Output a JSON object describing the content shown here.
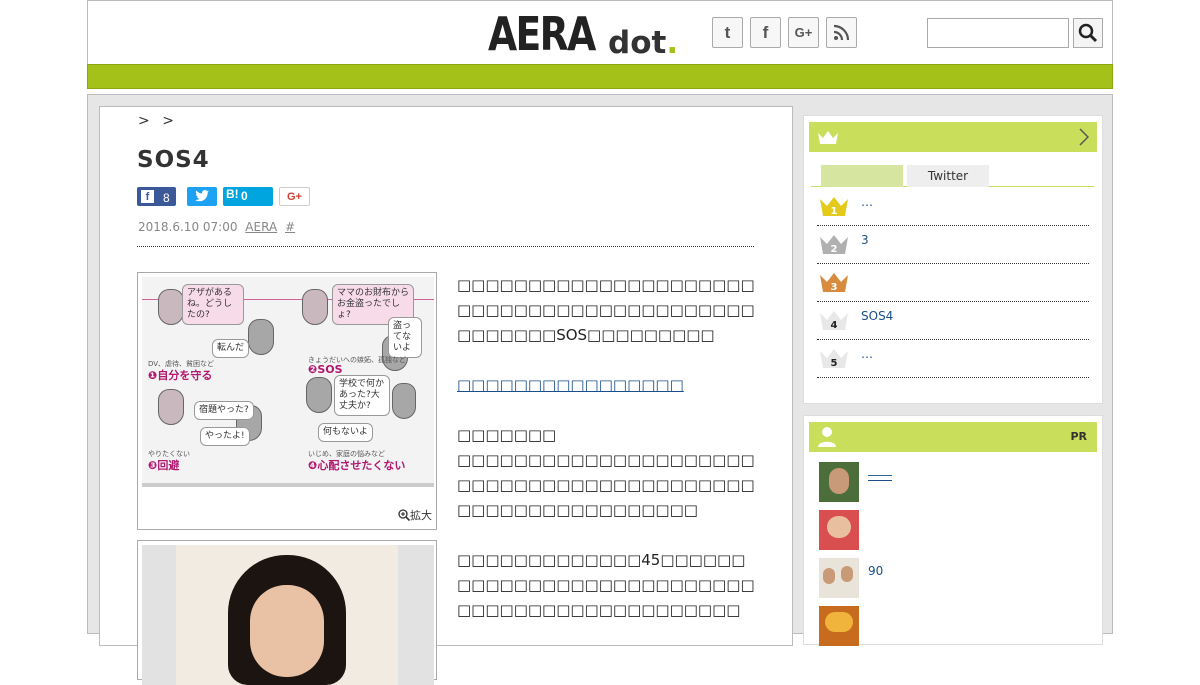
{
  "header": {
    "logo_main": "AERA",
    "logo_sub": "dot",
    "logo_period": ".",
    "social": {
      "twitter": "t",
      "facebook": "f",
      "google_plus": "G+",
      "rss": "RSS"
    },
    "search": {
      "value": "",
      "button_icon": "search-icon"
    }
  },
  "colors": {
    "accent": "#a4c11a",
    "sidebar_head": "#c9de5a",
    "link": "#1a4f8b",
    "caption": "#b2186f"
  },
  "article": {
    "breadcrumb": [
      ">",
      ">"
    ],
    "title": "SOS4",
    "share": {
      "facebook_count": "8",
      "hatena_label": "B!",
      "hatena_count": "0",
      "gplus_label": "G+"
    },
    "date": "2018.6.10 07:00",
    "source": "AERA",
    "tag": "#",
    "figure1": {
      "zoom_label": "拡大",
      "bubbles": [
        "アザがあるね。どうしたの?",
        "転んだ",
        "ママのお財布からお金盗ったでしょ?",
        "盗ってないよ",
        "宿題やった?",
        "やったよ!",
        "学校で何かあった?大丈夫か?",
        "何もないよ"
      ],
      "captions": [
        "❶自分を守る",
        "❷SOS",
        "❸回避",
        "❹心配させたくない"
      ],
      "sub_captions": [
        "DV、虐待、貧困など",
        "きょうだいへの嫉妬、孤独など",
        "やりたくない",
        "いじめ、家庭の悩みなど"
      ]
    },
    "paragraphs": [
      "□□□□□□□□□□□□□□□□□□□□□□□□□□□□□□□□□□□□□□□□□□□□□□□□□SOS□□□□□□□□□",
      "□□□□□□□□□□□□□□□□",
      "□□□□□□□",
      "□□□□□□□□□□□□□□□□□□□□□□□□□□□□□□□□□□□□□□□□□□□□□□□□□□□□□□□□□□□",
      "□□□□□□□□□□□□□45□□□□□□□□□□□□□□□□□□□□□□□□□□□□□□□□□□□□□□□□□□□□□□□"
    ]
  },
  "ranking": {
    "tabs": [
      "",
      "Twitter"
    ],
    "items": [
      {
        "rank": "1",
        "text": "…"
      },
      {
        "rank": "2",
        "text": "3"
      },
      {
        "rank": "3",
        "text": ""
      },
      {
        "rank": "4",
        "text": "SOS4"
      },
      {
        "rank": "5",
        "text": "…"
      }
    ]
  },
  "pr": {
    "label": "PR",
    "items": [
      {
        "text": "――"
      },
      {
        "text": ""
      },
      {
        "text": "90"
      },
      {
        "text": ""
      }
    ]
  }
}
